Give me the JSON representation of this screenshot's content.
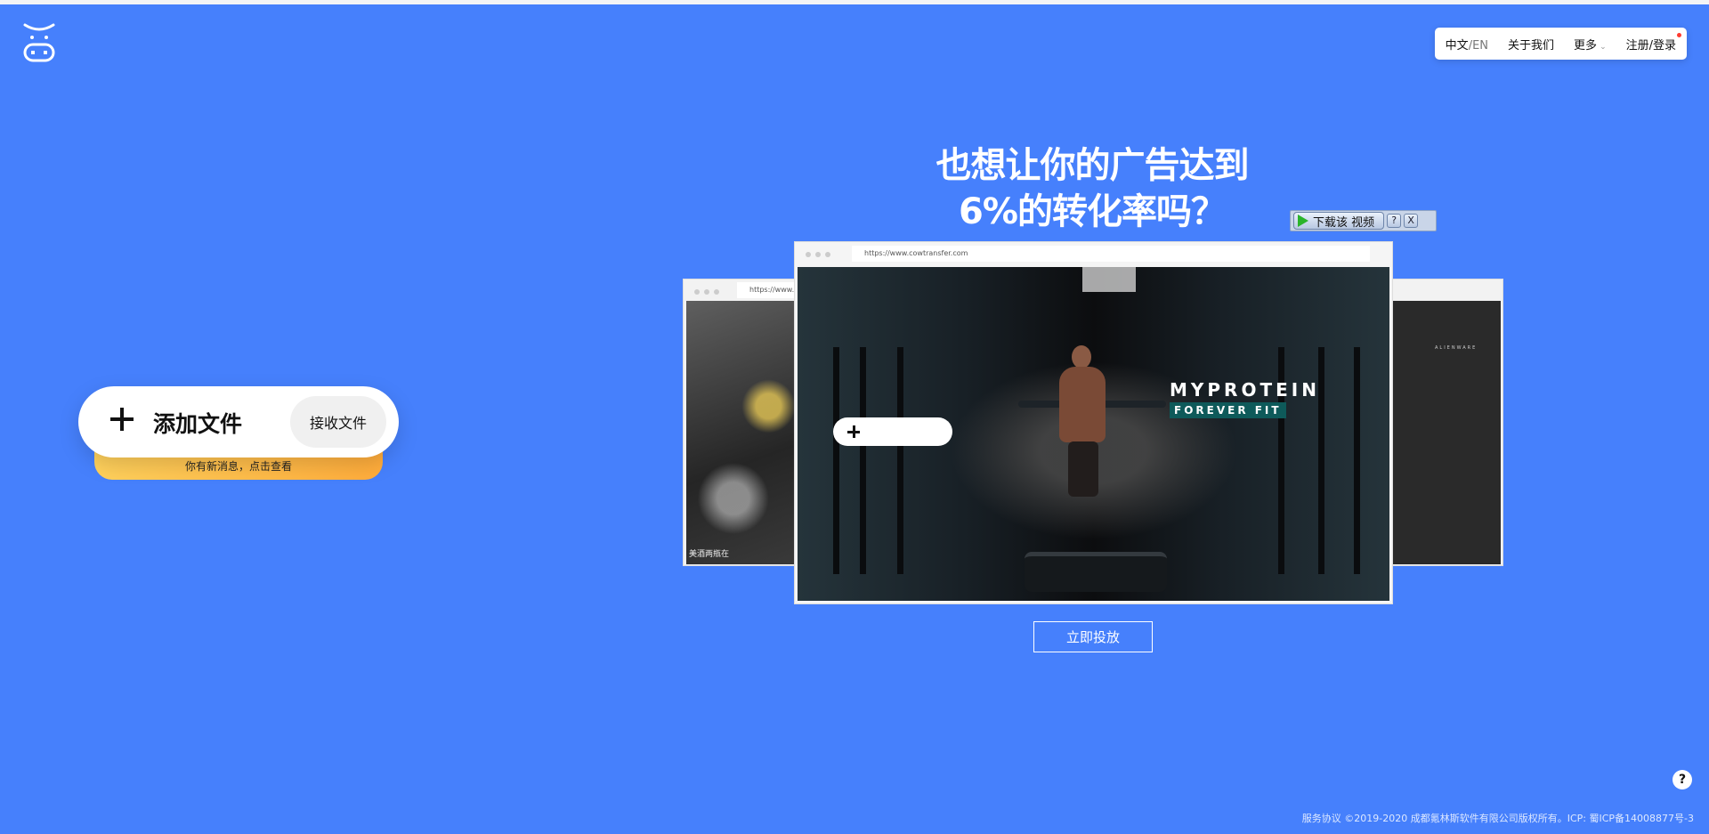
{
  "nav": {
    "lang_cn": "中文",
    "lang_sep": "/",
    "lang_en": "EN",
    "about": "关于我们",
    "more": "更多",
    "login": "注册/登录"
  },
  "uploader": {
    "add_label": "添加文件",
    "receive_label": "接收文件",
    "notice": "你有新消息，点击查看"
  },
  "promo": {
    "line1": "也想让你的广告达到",
    "line2": "6%的转化率吗？",
    "url": "https://www.cowtransfer.com",
    "left_url": "https://www.cow",
    "left_caption": "美酒两瓶在",
    "right_caption": "ALIENWARE",
    "brand": "MYPROTEIN",
    "tagline": "FOREVER FIT",
    "cta": "立即投放"
  },
  "download_bar": {
    "label": "下载该 视频",
    "help": "?",
    "close": "X"
  },
  "help_button": "?",
  "footer": {
    "terms": "服务协议",
    "copyright": "©2019-2020 成都氪林斯软件有限公司版权所有。ICP: 蜀ICP备14008877号-3"
  },
  "colors": {
    "background": "#4680fc",
    "notice_gradient": [
      "#ffd15c",
      "#ffac3b"
    ],
    "brand_tagline": "#0e5a5a"
  },
  "icons": {
    "logo": "cow-logo-icon",
    "add": "plus-icon",
    "play": "play-icon"
  }
}
